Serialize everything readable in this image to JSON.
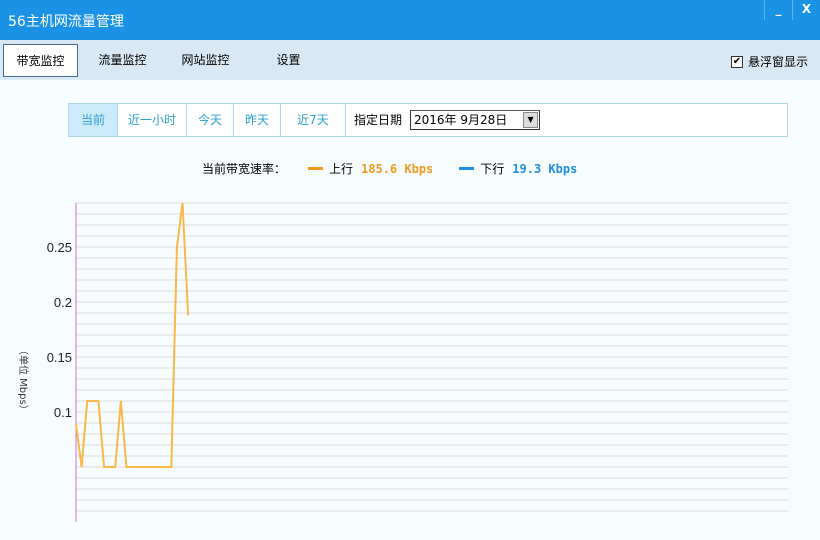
{
  "window": {
    "title": "56主机网流量管理",
    "minimize": "_",
    "close": "X"
  },
  "tabs": [
    {
      "label": "带宽监控",
      "active": true
    },
    {
      "label": "流量监控"
    },
    {
      "label": "网站监控"
    },
    {
      "label": "设置"
    }
  ],
  "float_window": {
    "label": "悬浮窗显示",
    "checked": true,
    "mark": "✔"
  },
  "filters": [
    {
      "label": "当前",
      "active": true
    },
    {
      "label": "近一小时"
    },
    {
      "label": "今天"
    },
    {
      "label": "昨天"
    },
    {
      "label": "近7天"
    }
  ],
  "date": {
    "label": "指定日期",
    "value": "2016年  9月28日"
  },
  "legend": {
    "title": "当前带宽速率：",
    "up_label": "上行",
    "up_value": "185.6 Kbps",
    "down_label": "下行",
    "down_value": "19.3 Kbps",
    "up_color": "#f39a1e",
    "down_color": "#1e8fe6"
  },
  "chart_data": {
    "type": "line",
    "ylabel": "（单位 Mbps）",
    "ylim": [
      0,
      0.29
    ],
    "xlim": [
      0,
      127
    ],
    "yticks": [
      0.1,
      0.15,
      0.2,
      0.25
    ],
    "ytick_labels": [
      "0.1",
      "0.15",
      "0.2",
      "0.25"
    ],
    "grid": true,
    "series": [
      {
        "name": "上行",
        "color": "#f8b84a",
        "x": [
          0,
          1,
          2,
          3,
          4,
          5,
          6,
          7,
          8,
          9,
          10,
          11,
          12,
          13,
          14,
          15,
          16,
          17,
          18,
          19,
          20
        ],
        "values": [
          0.089,
          0.05,
          0.11,
          0.11,
          0.11,
          0.05,
          0.05,
          0.05,
          0.11,
          0.05,
          0.05,
          0.05,
          0.05,
          0.05,
          0.05,
          0.05,
          0.05,
          0.05,
          0.25,
          0.29,
          0.188
        ]
      }
    ]
  }
}
